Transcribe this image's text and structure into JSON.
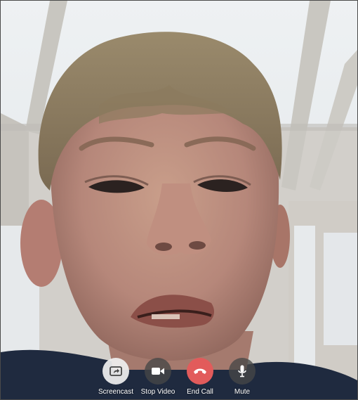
{
  "call": {
    "controls": [
      {
        "id": "screencast",
        "label": "Screencast",
        "icon": "screencast-icon"
      },
      {
        "id": "stop-video",
        "label": "Stop Video",
        "icon": "video-camera-icon"
      },
      {
        "id": "end-call",
        "label": "End Call",
        "icon": "phone-hangup-icon"
      },
      {
        "id": "mute",
        "label": "Mute",
        "icon": "microphone-icon"
      }
    ],
    "colors": {
      "end_call": "#e25b5b",
      "neutral_button": "#464646",
      "screencast_button": "#f0f0f0"
    }
  }
}
